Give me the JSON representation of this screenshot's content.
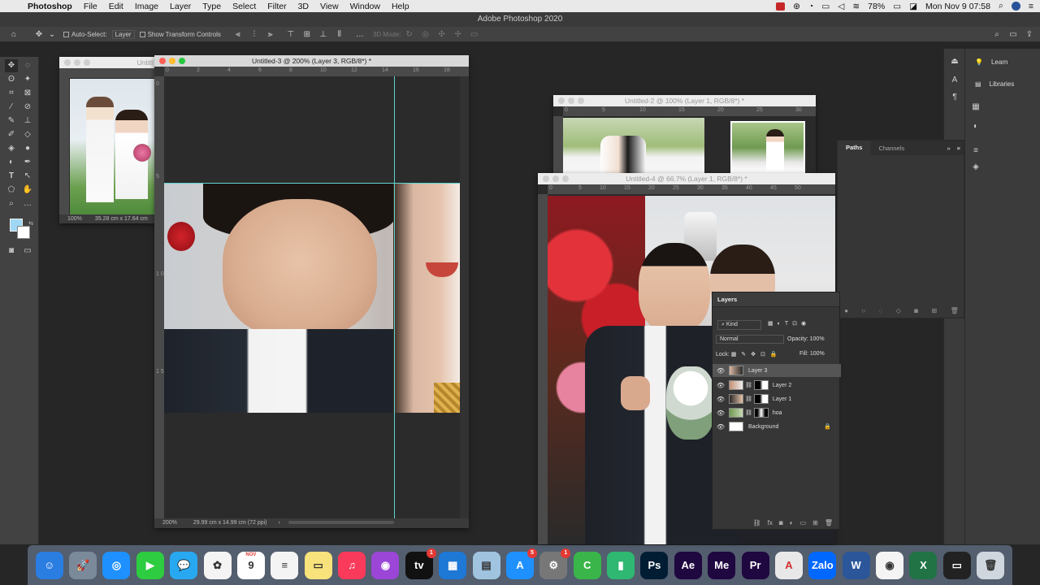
{
  "menubar": {
    "app_name": "Photoshop",
    "menus": [
      "File",
      "Edit",
      "Image",
      "Layer",
      "Type",
      "Select",
      "Filter",
      "3D",
      "View",
      "Window",
      "Help"
    ],
    "battery": "78%",
    "datetime": "Mon Nov 9  07:58"
  },
  "app_title": "Adobe Photoshop 2020",
  "options_bar": {
    "auto_select_label": "Auto-Select:",
    "auto_select_value": "Layer",
    "transform_controls_label": "Show Transform Controls",
    "mode_3d_label": "3D Mode:"
  },
  "windows": {
    "untitled1": {
      "title": "Untitl",
      "zoom": "100%",
      "size": "35.28 cm x 17.64 cm"
    },
    "untitled3": {
      "title": "Untitled-3 @ 200% (Layer 3, RGB/8*) *",
      "zoom": "200%",
      "size": "29.99 cm x 14.99 cm (72 ppi)",
      "ruler_h": [
        "0",
        "2",
        "4",
        "6",
        "8",
        "10",
        "12",
        "14",
        "16",
        "18"
      ],
      "ruler_v": [
        "0",
        "5",
        "1 0",
        "1 5"
      ]
    },
    "untitled2": {
      "title": "Untitled-2 @ 100% (Layer 1, RGB/8*) *",
      "ruler_h": [
        "0",
        "5",
        "10",
        "15",
        "20",
        "25",
        "30"
      ]
    },
    "untitled4": {
      "title": "Untitled-4 @ 66.7% (Layer 1, RGB/8*) *",
      "ruler_h": [
        "0",
        "5",
        "10",
        "15",
        "20",
        "25",
        "30",
        "35",
        "40",
        "45",
        "50"
      ]
    }
  },
  "right_panel": {
    "learn": "Learn",
    "libraries": "Libraries"
  },
  "paths_panel": {
    "tabs": [
      "Paths",
      "Channels"
    ]
  },
  "layers_panel": {
    "title": "Layers",
    "kind": "Kind",
    "blend_mode": "Normal",
    "opacity_label": "Opacity:",
    "opacity_value": "100%",
    "lock_label": "Lock:",
    "fill_label": "Fill:",
    "fill_value": "100%",
    "layers": [
      {
        "name": "Layer 3",
        "selected": true
      },
      {
        "name": "Layer 2",
        "selected": false
      },
      {
        "name": "Layer 1",
        "selected": false
      },
      {
        "name": "hoa",
        "selected": false
      },
      {
        "name": "Background",
        "selected": false
      }
    ]
  },
  "dock": {
    "apps": [
      {
        "name": "Finder",
        "color": "#2a7de1",
        "glyph": "☺"
      },
      {
        "name": "Launchpad",
        "color": "#7a8a9a",
        "glyph": "🚀"
      },
      {
        "name": "Safari",
        "color": "#1e90ff",
        "glyph": "◎"
      },
      {
        "name": "FaceTime",
        "color": "#2ecc40",
        "glyph": "▶"
      },
      {
        "name": "Messages",
        "color": "#28a8f0",
        "glyph": "💬"
      },
      {
        "name": "Photos",
        "color": "#f4f4f4",
        "glyph": "✿"
      },
      {
        "name": "Calendar",
        "color": "#ffffff",
        "glyph": "9"
      },
      {
        "name": "Reminders",
        "color": "#f4f4f4",
        "glyph": "≡"
      },
      {
        "name": "Notes",
        "color": "#f7e27b",
        "glyph": "▭"
      },
      {
        "name": "Music",
        "color": "#fa3a5a",
        "glyph": "♫"
      },
      {
        "name": "Podcasts",
        "color": "#9b46d6",
        "glyph": "◉"
      },
      {
        "name": "Apple TV",
        "color": "#111111",
        "glyph": "tv"
      },
      {
        "name": "Keynote",
        "color": "#1e78d6",
        "glyph": "▦"
      },
      {
        "name": "Preview",
        "color": "#a0c4e0",
        "glyph": "▤"
      },
      {
        "name": "App Store",
        "color": "#1e90ff",
        "glyph": "A"
      },
      {
        "name": "System Preferences",
        "color": "#777777",
        "glyph": "⚙"
      },
      {
        "name": "Camtasia",
        "color": "#3ab54a",
        "glyph": "C"
      },
      {
        "name": "Numbers",
        "color": "#2eb872",
        "glyph": "▮"
      },
      {
        "name": "Photoshop",
        "color": "#001d34",
        "glyph": "Ps"
      },
      {
        "name": "After Effects",
        "color": "#1f0740",
        "glyph": "Ae"
      },
      {
        "name": "Media Encoder",
        "color": "#1f0740",
        "glyph": "Me"
      },
      {
        "name": "Premiere Pro",
        "color": "#1f0740",
        "glyph": "Pr"
      },
      {
        "name": "Acrobat",
        "color": "#e8e8e8",
        "glyph": "A"
      },
      {
        "name": "Zalo",
        "color": "#0068ff",
        "glyph": "Zalo"
      },
      {
        "name": "Word",
        "color": "#2b579a",
        "glyph": "W"
      },
      {
        "name": "Chrome",
        "color": "#f4f4f4",
        "glyph": "◉"
      },
      {
        "name": "Excel",
        "color": "#217346",
        "glyph": "X"
      },
      {
        "name": "Screen",
        "color": "#222222",
        "glyph": "▭"
      },
      {
        "name": "Trash",
        "color": "#cfd6dd",
        "glyph": "🗑"
      }
    ],
    "badges": {
      "Apple TV": "1",
      "App Store": "5",
      "System Preferences": "1"
    },
    "calendar_month": "NOV"
  }
}
